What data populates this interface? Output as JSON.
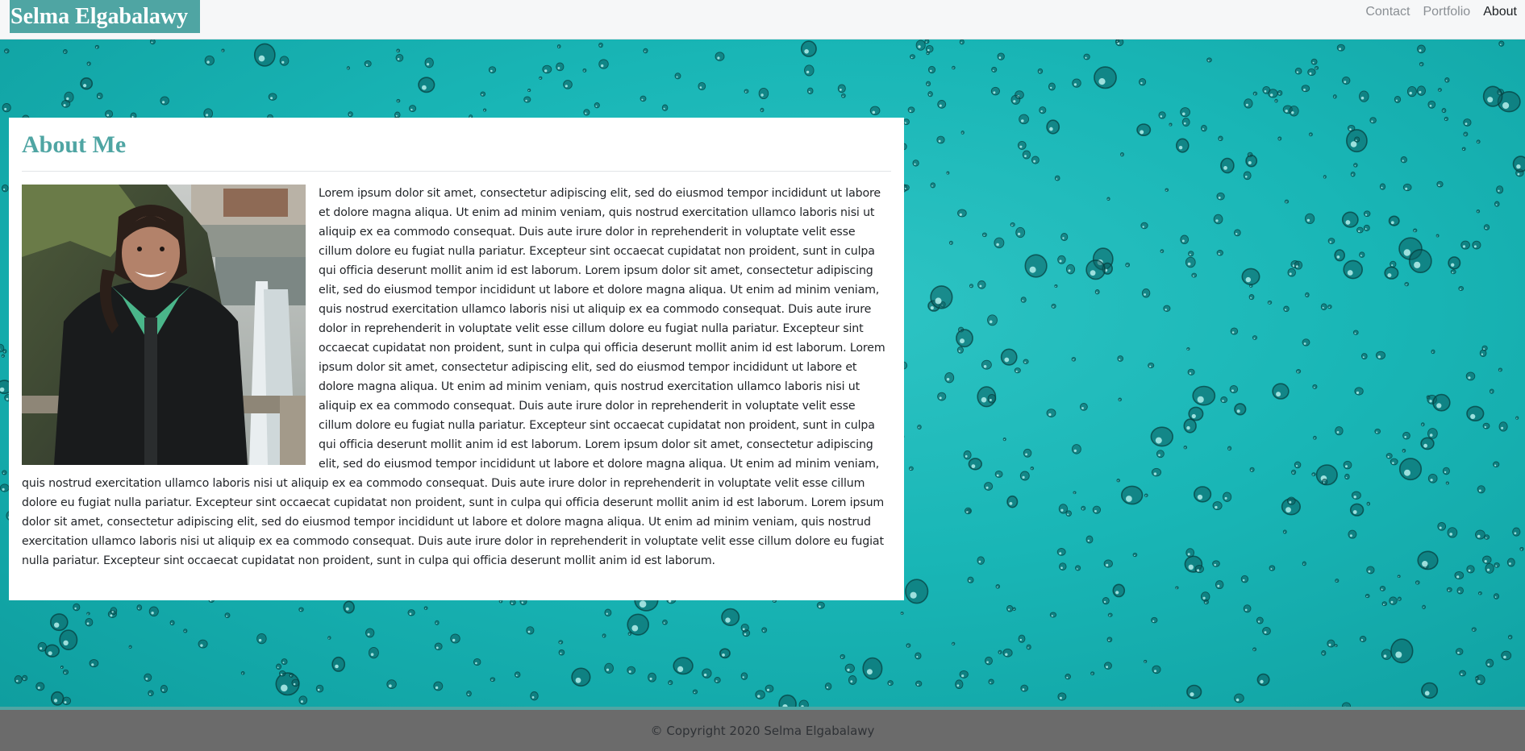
{
  "nav": {
    "brand": "Selma Elgabalawy",
    "links": [
      "Contact",
      "Portfolio",
      "About"
    ],
    "active": "About"
  },
  "about": {
    "title": "About Me",
    "text": "Lorem ipsum dolor sit amet, consectetur adipiscing elit, sed do eiusmod tempor incididunt ut labore et dolore magna aliqua. Ut enim ad minim veniam, quis nostrud exercitation ullamco laboris nisi ut aliquip ex ea commodo consequat. Duis aute irure dolor in reprehenderit in voluptate velit esse cillum dolore eu fugiat nulla pariatur. Excepteur sint occaecat cupidatat non proident, sunt in culpa qui officia deserunt mollit anim id est laborum. Lorem ipsum dolor sit amet, consectetur adipiscing elit, sed do eiusmod tempor incididunt ut labore et dolore magna aliqua. Ut enim ad minim veniam, quis nostrud exercitation ullamco laboris nisi ut aliquip ex ea commodo consequat. Duis aute irure dolor in reprehenderit in voluptate velit esse cillum dolore eu fugiat nulla pariatur. Excepteur sint occaecat cupidatat non proident, sunt in culpa qui officia deserunt mollit anim id est laborum. Lorem ipsum dolor sit amet, consectetur adipiscing elit, sed do eiusmod tempor incididunt ut labore et dolore magna aliqua. Ut enim ad minim veniam, quis nostrud exercitation ullamco laboris nisi ut aliquip ex ea commodo consequat. Duis aute irure dolor in reprehenderit in voluptate velit esse cillum dolore eu fugiat nulla pariatur. Excepteur sint occaecat cupidatat non proident, sunt in culpa qui officia deserunt mollit anim id est laborum. Lorem ipsum dolor sit amet, consectetur adipiscing elit, sed do eiusmod tempor incididunt ut labore et dolore magna aliqua. Ut enim ad minim veniam, quis nostrud exercitation ullamco laboris nisi ut aliquip ex ea commodo consequat. Duis aute irure dolor in reprehenderit in voluptate velit esse cillum dolore eu fugiat nulla pariatur. Excepteur sint occaecat cupidatat non proident, sunt in culpa qui officia deserunt mollit anim id est laborum. Lorem ipsum dolor sit amet, consectetur adipiscing elit, sed do eiusmod tempor incididunt ut labore et dolore magna aliqua. Ut enim ad minim veniam, quis nostrud exercitation ullamco laboris nisi ut aliquip ex ea commodo consequat. Duis aute irure dolor in reprehenderit in voluptate velit esse cillum dolore eu fugiat nulla pariatur. Excepteur sint occaecat cupidatat non proident, sunt in culpa qui officia deserunt mollit anim id est laborum."
  },
  "footer": {
    "copyright": "© Copyright 2020 Selma Elgabalawy"
  },
  "colors": {
    "accent": "#4fa5a3",
    "background_teal": "#19b6b6",
    "footer_bg": "#6b6b6b",
    "navbar_bg": "#f6f7f8"
  },
  "icons": {
    "hero_background": "water-droplets-image",
    "portrait": "profile-photo"
  }
}
